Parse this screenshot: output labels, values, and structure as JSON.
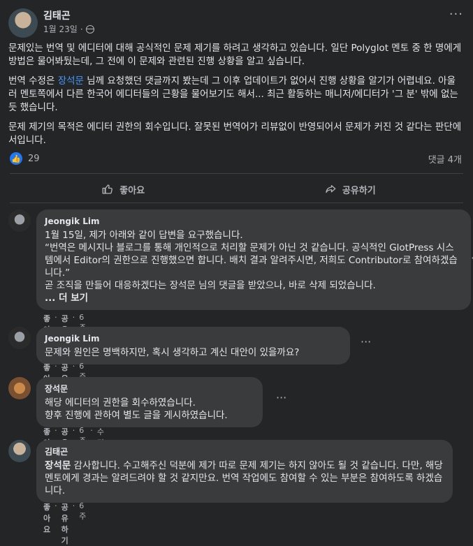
{
  "post": {
    "author": "김태곤",
    "date": "1월 23일",
    "dot": "·",
    "more_icon": "···",
    "body_parts": {
      "p1": "문제있는 번역 및 에디터에 대해 공식적인 문제 제기를 하려고 생각하고 있습니다. 일단 Polyglot 멘토 중 한 명에게 방법은 물어봐뒀는데, 그 전에 이 문제와 관련된 진행 상황을 알고 싶습니다.",
      "p2_before": "번역 수정은 ",
      "p2_mention": "장석문",
      "p2_after": " 님께 요청했던 댓글까지 봤는데 그 이후 업데이트가 없어서 진행 상황을 알기가 어렵네요. 아울러 멘토쪽에서 다른 한국어 에디터들의 근황을 물어보기도 해서... 최근 활동하는 매니저/에디터가 '그 분' 밖에 없는 듯 했습니다.",
      "p3": "문제 제기의 목적은 에디터 권한의 회수입니다. 잘못된 번역어가 리뷰없이 반영되어서 문제가 커진 것 같다는 판단에서입니다."
    },
    "reaction_count": "29",
    "comment_count": "댓글 4개",
    "like_label": "좋아요",
    "share_label": "공유하기"
  },
  "comments": [
    {
      "name": "Jeongik Lim",
      "text": "1월 15일, 제가 아래와 같이 답변을 요구했습니다.\n“번역은 메시지나 블로그를 통해 개인적으로 처리할 문제가 아닌 것 같습니다. 공식적인 GlotPress 시스템에서 Editor의 권한으로 진행했으면 합니다. 배치 결과 알려주시면, 저희도 Contributor로 참여하겠습니다.”\n곧 조직을 만들어 대응하겠다는 장석문 님의 댓글을 받았으나, 바로 삭제 되었습니다.",
      "more": "... 더 보기",
      "like": "좋아요",
      "share": "공유하기",
      "time": "6주"
    },
    {
      "name": "Jeongik Lim",
      "text": "문제와 원인은 명백하지만, 혹시 생각하고 계신 대안이 있을까요?",
      "like": "좋아요",
      "share": "공유하기",
      "time": "6주"
    },
    {
      "name": "장석문",
      "text": "해당 에디터의 권한을 회수하였습니다.\n향후 진행에 관하여 별도 글을 게시하였습니다.",
      "like": "좋아요",
      "share": "공유하기",
      "time": "6주",
      "edited": "수정됨"
    },
    {
      "name": "김태곤",
      "mention": "장석문",
      "text": " 감사합니다. 수고해주신 덕분에 제가 따로 문제 제기는 하지 않아도 될 것 같습니다. 다만, 해당 멘토에게 경과는 알려드려야 할 것 같지만요. 번역 작업에도 참여할 수 있는 부분은 참여하도록 하겠습니다.",
      "like": "좋아요",
      "share": "공유하기",
      "time": "6주"
    }
  ],
  "colors": {
    "background": "#242526",
    "bubble": "#3a3b3c",
    "accent": "#2078f4",
    "mention": "#4599ff"
  }
}
